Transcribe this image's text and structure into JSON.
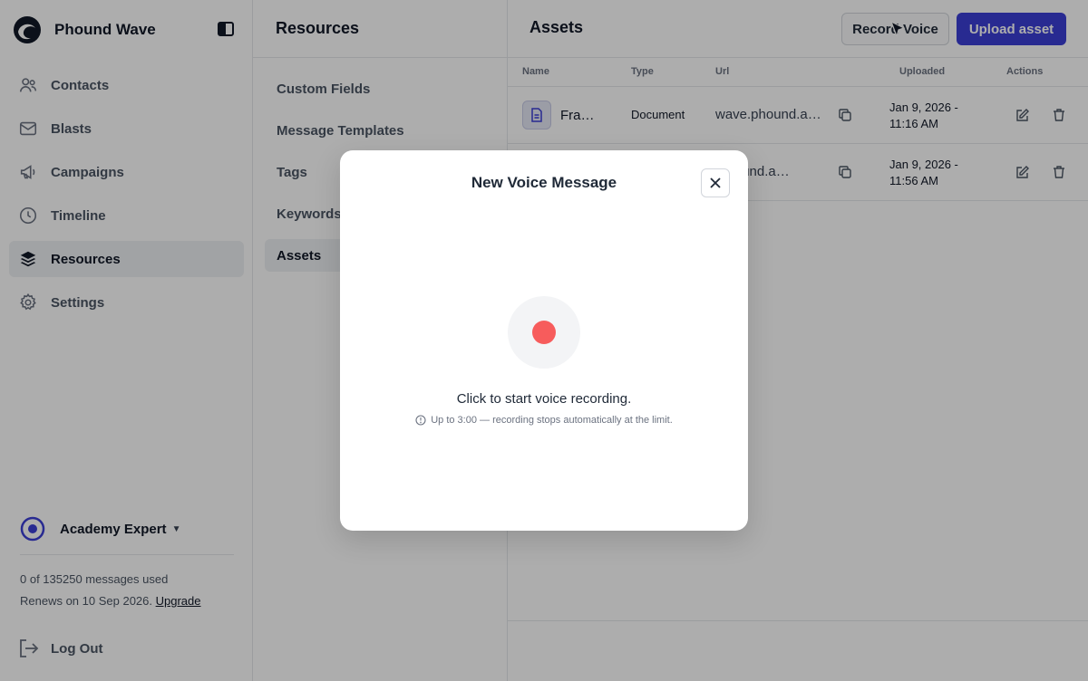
{
  "brand": {
    "name": "Phound Wave"
  },
  "sidebar": {
    "items": [
      {
        "label": "Contacts",
        "icon": "contacts-icon"
      },
      {
        "label": "Blasts",
        "icon": "mail-icon"
      },
      {
        "label": "Campaigns",
        "icon": "megaphone-icon"
      },
      {
        "label": "Timeline",
        "icon": "clock-icon"
      },
      {
        "label": "Resources",
        "icon": "layers-icon",
        "active": true
      },
      {
        "label": "Settings",
        "icon": "gear-icon"
      }
    ],
    "account": {
      "name": "Academy Expert"
    },
    "usage": {
      "line1": "0 of 135250 messages used",
      "line2": "Renews on 10 Sep 2026.",
      "upgrade": "Upgrade"
    },
    "logout": "Log Out"
  },
  "resources": {
    "title": "Resources",
    "items": [
      "Custom Fields",
      "Message Templates",
      "Tags",
      "Keywords",
      "Assets"
    ]
  },
  "assets": {
    "title": "Assets",
    "record_label": "Record Voice",
    "upload_label": "Upload asset",
    "columns": {
      "name": "Name",
      "type": "Type",
      "url": "Url",
      "uploaded": "Uploaded",
      "actions": "Actions"
    },
    "rows": [
      {
        "name": "Fra…",
        "type": "Document",
        "url": "wave.phound.a…",
        "date_line1": "Jan 9, 2026 -",
        "date_line2": "11:16 AM"
      },
      {
        "name": "",
        "type": "",
        "url": ".phound.a…",
        "date_line1": "Jan 9, 2026 -",
        "date_line2": "11:56 AM"
      }
    ]
  },
  "modal": {
    "title": "New Voice Message",
    "prompt": "Click to start voice recording.",
    "note": "Up to 3:00 — recording stops automatically at the limit."
  },
  "colors": {
    "accent": "#3b3fd6",
    "record": "#f75c5c"
  }
}
